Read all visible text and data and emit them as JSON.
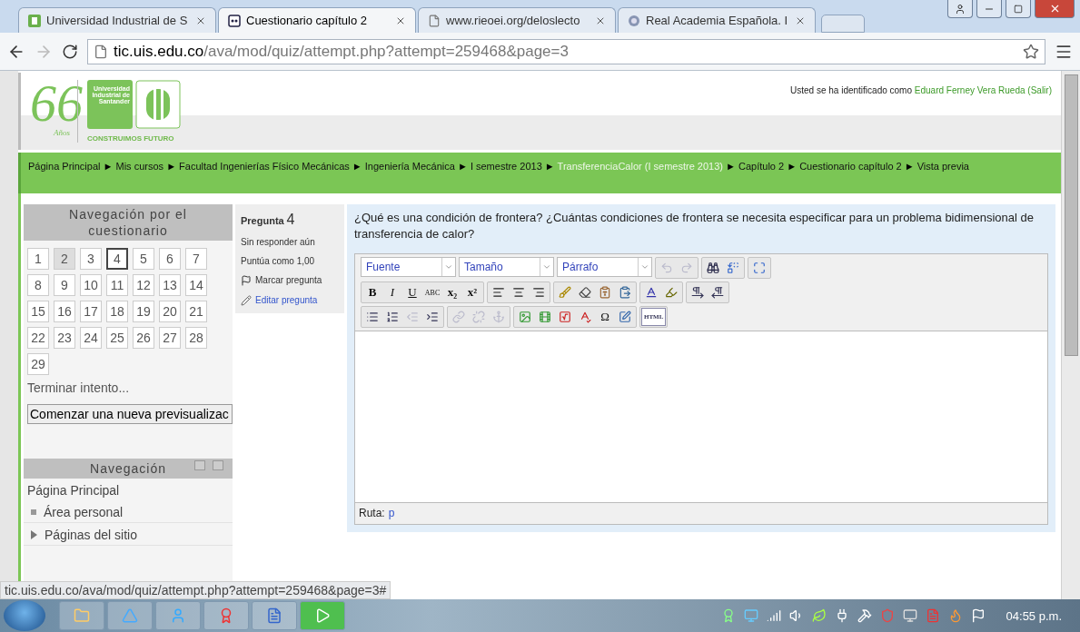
{
  "browser": {
    "tabs": [
      {
        "title": "Universidad Industrial de S",
        "kind": "site",
        "selected": false
      },
      {
        "title": "Cuestionario capítulo 2",
        "kind": "quiz",
        "selected": true
      },
      {
        "title": "www.rieoei.org/deloslecto",
        "kind": "page",
        "selected": false
      },
      {
        "title": "Real Academia Española. I",
        "kind": "seal",
        "selected": false
      }
    ],
    "address": {
      "host": "tic.uis.edu.co",
      "path": "/ava/mod/quiz/attempt.php?attempt=259468&page=3"
    }
  },
  "header": {
    "logo_number": "66",
    "logo_word": "Años",
    "university": "Universidad Industrial de Santander",
    "slogan": "CONSTRUIMOS FUTURO",
    "login": {
      "prefix": "Usted se ha identificado como",
      "user": "Eduard Ferney Vera Rueda",
      "logout": "(Salir)"
    }
  },
  "breadcrumb": [
    {
      "label": "Página Principal",
      "dimmed": false,
      "sep": "►"
    },
    {
      "label": "Mis cursos",
      "dimmed": false,
      "sep": "►"
    },
    {
      "label": "Facultad Ingenierías Físico Mecánicas",
      "dimmed": false,
      "sep": "►"
    },
    {
      "label": "Ingeniería Mecánica",
      "dimmed": false,
      "sep": "►"
    },
    {
      "label": "I semestre 2013",
      "dimmed": false,
      "sep": "►"
    },
    {
      "label": "TransferenciaCalor (I semestre 2013)",
      "dimmed": true,
      "sep": "►"
    },
    {
      "label": "Capítulo 2",
      "dimmed": false,
      "sep": "►"
    },
    {
      "label": "Cuestionario capítulo 2",
      "dimmed": false,
      "sep": "►"
    },
    {
      "label": "Vista previa",
      "dimmed": false
    }
  ],
  "quiz_nav": {
    "title": "Navegación por el cuestionario",
    "questions": [
      {
        "label": "1",
        "answered": false,
        "selected": false
      },
      {
        "label": "2",
        "answered": true,
        "selected": false
      },
      {
        "label": "3",
        "answered": false,
        "selected": false
      },
      {
        "label": "4",
        "answered": false,
        "selected": true
      },
      {
        "label": "5",
        "answered": false,
        "selected": false
      },
      {
        "label": "6",
        "answered": false,
        "selected": false
      },
      {
        "label": "7",
        "answered": false,
        "selected": false
      },
      {
        "label": "8",
        "answered": false,
        "selected": false
      },
      {
        "label": "9",
        "answered": false,
        "selected": false
      },
      {
        "label": "10",
        "answered": false,
        "selected": false
      },
      {
        "label": "11",
        "answered": false,
        "selected": false
      },
      {
        "label": "12",
        "answered": false,
        "selected": false
      },
      {
        "label": "13",
        "answered": false,
        "selected": false
      },
      {
        "label": "14",
        "answered": false,
        "selected": false
      },
      {
        "label": "15",
        "answered": false,
        "selected": false
      },
      {
        "label": "16",
        "answered": false,
        "selected": false
      },
      {
        "label": "17",
        "answered": false,
        "selected": false
      },
      {
        "label": "18",
        "answered": false,
        "selected": false
      },
      {
        "label": "19",
        "answered": false,
        "selected": false
      },
      {
        "label": "20",
        "answered": false,
        "selected": false
      },
      {
        "label": "21",
        "answered": false,
        "selected": false
      },
      {
        "label": "22",
        "answered": false,
        "selected": false
      },
      {
        "label": "23",
        "answered": false,
        "selected": false
      },
      {
        "label": "24",
        "answered": false,
        "selected": false
      },
      {
        "label": "25",
        "answered": false,
        "selected": false
      },
      {
        "label": "26",
        "answered": false,
        "selected": false
      },
      {
        "label": "27",
        "answered": false,
        "selected": false
      },
      {
        "label": "28",
        "answered": false,
        "selected": false
      },
      {
        "label": "29",
        "answered": false,
        "selected": false
      }
    ],
    "finish": "Terminar intento...",
    "restart": "Comenzar una nueva previsualizac"
  },
  "navigation": {
    "title": "Navegación",
    "items": [
      {
        "label": "Página Principal",
        "kind": "plain"
      },
      {
        "label": "Área personal",
        "kind": "bullet"
      },
      {
        "label": "Páginas del sitio",
        "kind": "expandable"
      }
    ]
  },
  "question_info": {
    "label": "Pregunta",
    "number": "4",
    "status": "Sin responder aún",
    "grade": "Puntúa como 1,00",
    "flag": "Marcar pregunta",
    "edit": "Editar pregunta"
  },
  "question": {
    "text": "¿Qué es una condición de frontera? ¿Cuántas condiciones de frontera se necesita especificar para un problema bidimensional de transferencia de calor?",
    "editor": {
      "rows": [
        {
          "selects": [
            "Fuente",
            "Tamaño",
            "Párrafo"
          ],
          "groups": [
            [
              {
                "kind": "undo",
                "disabled": true
              },
              {
                "kind": "redo",
                "disabled": true
              }
            ],
            [
              {
                "kind": "find",
                "disabled": false
              },
              {
                "kind": "replace",
                "disabled": false
              }
            ],
            [
              {
                "kind": "fullscreen",
                "disabled": false
              }
            ]
          ]
        },
        {
          "groups": [
            [
              {
                "kind": "bold",
                "label": "B",
                "disabled": false
              },
              {
                "kind": "italic",
                "label": "I",
                "disabled": false
              },
              {
                "kind": "underline",
                "label": "U",
                "disabled": false
              },
              {
                "kind": "strike",
                "label": "ABC",
                "disabled": false
              },
              {
                "kind": "subscript",
                "label": "x₂",
                "disabled": false
              },
              {
                "kind": "superscript",
                "label": "x²",
                "disabled": false
              }
            ],
            [
              {
                "kind": "align-left",
                "disabled": false
              },
              {
                "kind": "align-center",
                "disabled": false
              },
              {
                "kind": "align-right",
                "disabled": false
              }
            ],
            [
              {
                "kind": "brush",
                "disabled": false
              },
              {
                "kind": "eraser",
                "disabled": false
              },
              {
                "kind": "paste-text",
                "disabled": false
              },
              {
                "kind": "paste",
                "disabled": false
              }
            ],
            [
              {
                "kind": "text-color",
                "disabled": false
              },
              {
                "kind": "highlight",
                "disabled": false
              }
            ],
            [
              {
                "kind": "ltr",
                "disabled": false
              },
              {
                "kind": "rtl",
                "disabled": false
              }
            ]
          ]
        },
        {
          "groups": [
            [
              {
                "kind": "bullets",
                "disabled": false
              },
              {
                "kind": "numbers",
                "disabled": false
              },
              {
                "kind": "outdent",
                "disabled": true
              },
              {
                "kind": "indent",
                "disabled": false
              }
            ],
            [
              {
                "kind": "link",
                "disabled": true
              },
              {
                "kind": "unlink",
                "disabled": true
              },
              {
                "kind": "anchor",
                "disabled": true
              }
            ],
            [
              {
                "kind": "image",
                "disabled": false
              },
              {
                "kind": "media",
                "disabled": false
              },
              {
                "kind": "equation",
                "disabled": false
              },
              {
                "kind": "spellcheck",
                "disabled": false
              },
              {
                "kind": "symbol",
                "label": "Ω",
                "disabled": false
              },
              {
                "kind": "edit",
                "disabled": false
              }
            ],
            [
              {
                "kind": "html",
                "label": "HTML",
                "disabled": false
              }
            ]
          ]
        }
      ],
      "path_label": "Ruta:",
      "path": "p"
    }
  },
  "status_url": "tic.uis.edu.co/ava/mod/quiz/attempt.php?attempt=259468&page=3#",
  "taskbar": {
    "apps": [
      {
        "kind": "folder"
      },
      {
        "kind": "ie"
      },
      {
        "kind": "skype"
      },
      {
        "kind": "chrome"
      },
      {
        "kind": "word"
      },
      {
        "kind": "active"
      }
    ],
    "tray": [
      {
        "kind": "award"
      },
      {
        "kind": "disc"
      },
      {
        "kind": "signal"
      },
      {
        "kind": "volume"
      },
      {
        "kind": "leaf"
      },
      {
        "kind": "plug"
      },
      {
        "kind": "hammer"
      },
      {
        "kind": "shield"
      },
      {
        "kind": "monitor"
      },
      {
        "kind": "pdf"
      },
      {
        "kind": "java"
      },
      {
        "kind": "flag"
      }
    ],
    "clock": "04:55 p.m."
  }
}
